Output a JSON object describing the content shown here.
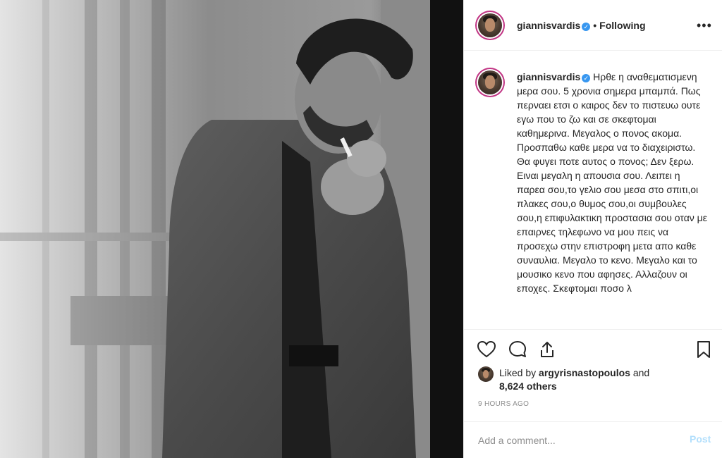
{
  "header": {
    "username": "giannisvardis",
    "verified_icon": "verified-badge-icon",
    "separator": "•",
    "follow_status": "Following",
    "more_label": "•••"
  },
  "caption": {
    "username": "giannisvardis",
    "text": "Ηρθε η αναθεματισμενη μερα σου. 5 χρονια σημερα μπαμπά. Πως περναει ετσι ο καιρος δεν το πιστευω ουτε εγω που το ζω και σε σκεφτομαι καθημερινα. Μεγαλος ο πονος ακομα. Προσπαθω καθε μερα να το διαχειριστω. Θα φυγει ποτε αυτος ο πονος; Δεν ξερω. Ειναι μεγαλη η απουσια σου. Λειπει η παρεα σου,το γελιο σου μεσα στο σπιτι,οι πλακες σου,ο θυμος σου,οι συμβουλες σου,η επιφυλακτικη προστασια σου οταν με επαιρνες τηλεφωνο να μου πεις να προσεχω στην επιστροφη μετα απο καθε συναυλια. Μεγαλο το κενο. Μεγαλο και το μουσικο κενο που αφησες. Αλλαζουν οι εποχες. Σκεφτομαι ποσο λ"
  },
  "actions": {
    "icons": [
      "heart-icon",
      "comment-icon",
      "share-icon",
      "bookmark-icon"
    ]
  },
  "likes": {
    "prefix": "Liked by",
    "user": "argyrisnastopoulos",
    "and": "and",
    "others": "8,624 others"
  },
  "timestamp": "9 HOURS AGO",
  "comment_box": {
    "placeholder": "Add a comment...",
    "post_label": "Post"
  },
  "colors": {
    "verified": "#3897f0",
    "post_disabled": "#b2dffc",
    "muted": "#8e8e8e",
    "text": "#262626"
  }
}
